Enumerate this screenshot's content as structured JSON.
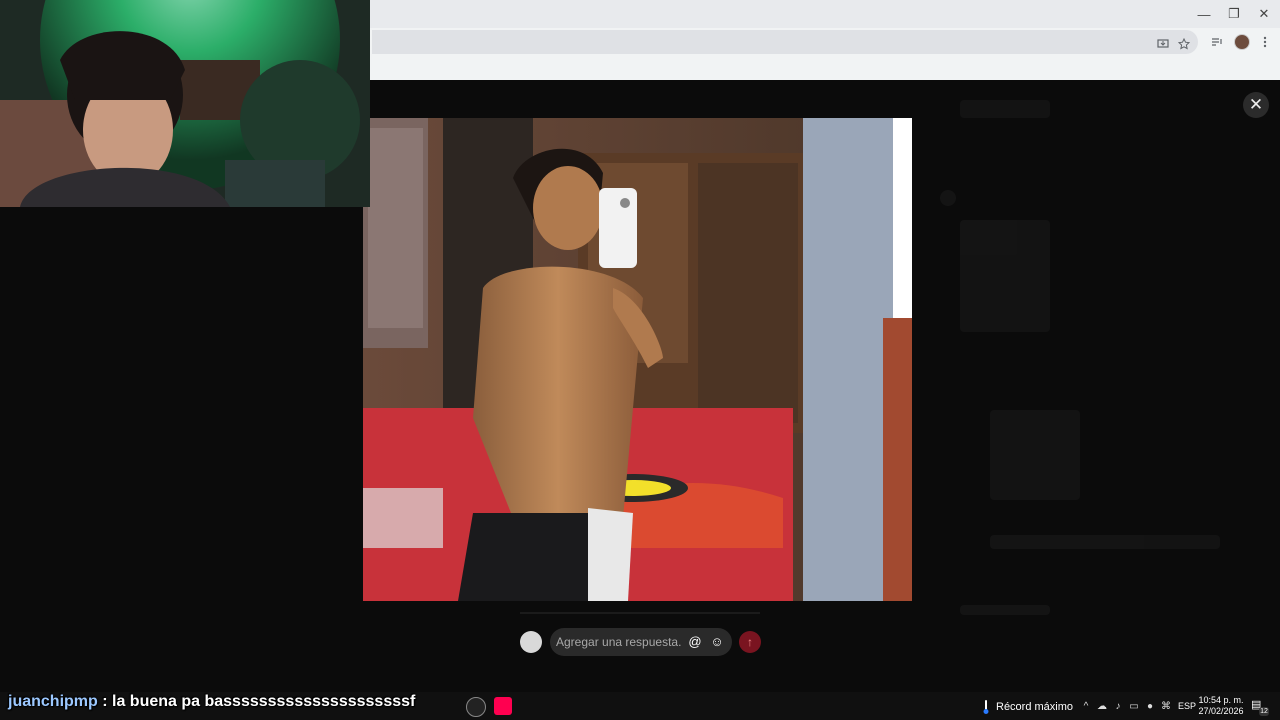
{
  "browser": {
    "window_controls": {
      "minimize": "—",
      "restore": "❐",
      "close": "✕"
    },
    "toolbar_icons": [
      "install-icon",
      "star-icon",
      "media-icon",
      "menu-icon"
    ]
  },
  "viewer": {
    "close_label": "✕",
    "reply_placeholder": "Agregar una respuesta...",
    "mention_label": "@",
    "emoji_label": "☺",
    "send_label": "↑"
  },
  "chat": {
    "user": "juanchipmp",
    "separator": " : ",
    "message": "la buena pa basssssssssssssssssssssf"
  },
  "taskbar": {
    "weather_text": "Récord máximo",
    "language": "ESP",
    "time": "10:54 p. m.",
    "date": "27/02/2026",
    "notification_count": "12"
  },
  "colors": {
    "overlay": "#0b0b0b",
    "browser_chrome": "#f1f3f4",
    "send_button": "#7a1420",
    "chat_user": "#9cc8ff"
  }
}
